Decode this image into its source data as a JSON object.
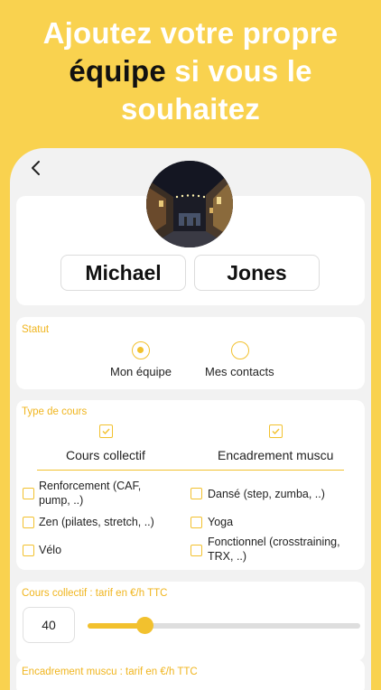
{
  "headline": {
    "line1": "Ajoutez votre propre",
    "line2_em": "équipe",
    "line2_rest": " si vous le",
    "line3": "souhaitez"
  },
  "profile": {
    "first_name": "Michael",
    "last_name": "Jones"
  },
  "statut": {
    "label": "Statut",
    "options": [
      {
        "label": "Mon équipe",
        "selected": true
      },
      {
        "label": "Mes contacts",
        "selected": false
      }
    ]
  },
  "type_cours": {
    "label": "Type de cours",
    "categories": [
      {
        "label": "Cours collectif",
        "checked": true
      },
      {
        "label": "Encadrement muscu",
        "checked": true
      }
    ],
    "options": [
      {
        "line1": "Renforcement (CAF,",
        "line2": "pump, ..)",
        "checked": false
      },
      {
        "line1": "Dansé (step, zumba, ..)",
        "line2": "",
        "checked": false
      },
      {
        "line1": "Zen (pilates, stretch, ..)",
        "line2": "",
        "checked": false
      },
      {
        "line1": "Yoga",
        "line2": "",
        "checked": false
      },
      {
        "line1": "Vélo",
        "line2": "",
        "checked": false
      },
      {
        "line1": "Fonctionnel (crosstraining,",
        "line2": "TRX, ..)",
        "checked": false
      }
    ]
  },
  "tarif_collectif": {
    "label": "Cours collectif : tarif en €/h TTC",
    "value": "40",
    "slider_fraction": 0.21
  },
  "tarif_muscu": {
    "label": "Encadrement muscu : tarif en €/h TTC"
  },
  "colors": {
    "background": "#F9D24F",
    "accent": "#F2C12E",
    "label": "#F0B51E"
  }
}
